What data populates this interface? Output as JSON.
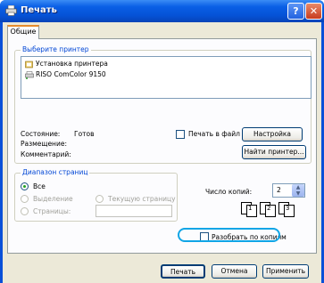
{
  "window": {
    "title": "Печать",
    "help_label": "?",
    "close_label": "✕"
  },
  "tabs": [
    {
      "label": "Общие"
    }
  ],
  "printer_group": {
    "label": "Выберите принтер",
    "items": [
      {
        "label": "Установка принтера",
        "icon": "add-printer-icon"
      },
      {
        "label": "RISO ComColor 9150",
        "icon": "printer-icon"
      }
    ]
  },
  "status": {
    "state_label": "Состояние:",
    "state_value": "Готов",
    "location_label": "Размещение:",
    "comment_label": "Комментарий:"
  },
  "print_to_file": {
    "label": "Печать в файл",
    "checked": false
  },
  "buttons": {
    "settings": "Настройка",
    "find_printer": "Найти принтер..."
  },
  "range_group": {
    "label": "Диапазон страниц",
    "all": "Все",
    "selection": "Выделение",
    "current": "Текущую страницу",
    "pages": "Страницы:",
    "selected": "Все"
  },
  "copies": {
    "label": "Число копий:",
    "value": "2"
  },
  "collate": {
    "label": "Разобрать по копиям",
    "checked": false
  },
  "collate_icons": [
    "1",
    "1",
    "2",
    "2",
    "3",
    "3"
  ],
  "footer": {
    "print": "Печать",
    "cancel": "Отмена",
    "apply": "Применить"
  },
  "colors": {
    "highlight": "#10a5e6",
    "title_bar": "#0552d6",
    "group_label": "#0046d5"
  }
}
